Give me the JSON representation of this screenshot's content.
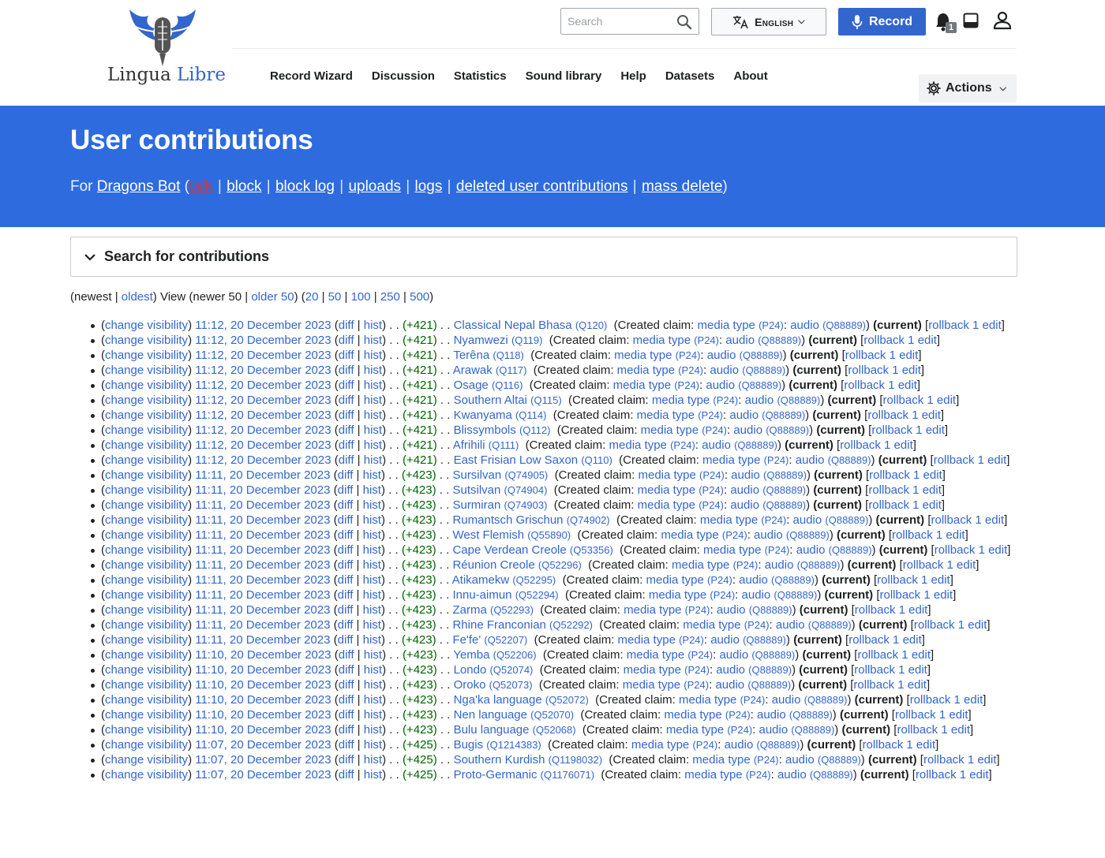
{
  "header": {
    "logo_text_a": "Lingua",
    "logo_text_b": "Libre",
    "search_placeholder": "Search",
    "language_label": "English",
    "record_label": "Record",
    "notification_count": "1",
    "actions_label": "Actions",
    "nav": [
      "Record Wizard",
      "Discussion",
      "Statistics",
      "Sound library",
      "Help",
      "Datasets",
      "About"
    ]
  },
  "banner": {
    "title": "User contributions",
    "for_prefix": "For",
    "user": "Dragons Bot",
    "links": [
      "talk",
      "block",
      "block log",
      "uploads",
      "logs",
      "deleted user contributions",
      "mass delete"
    ]
  },
  "search_panel": {
    "label": "Search for contributions"
  },
  "pager": {
    "newest": "newest",
    "oldest": "oldest",
    "view": "View",
    "newer": "newer 50",
    "older": "older 50",
    "sizes": [
      "20",
      "50",
      "100",
      "250",
      "500"
    ]
  },
  "labels": {
    "change_visibility": "change visibility",
    "diff": "diff",
    "hist": "hist",
    "created_claim": "Created claim:",
    "media_type": "media type",
    "media_type_id": "(P24)",
    "audio": "audio",
    "audio_id": "(Q88889)",
    "current": "(current)",
    "rollback": "rollback 1 edit"
  },
  "contributions": [
    {
      "time": "11:12, 20 December 2023",
      "size": "(+421)",
      "page": "Classical Nepal Bhasa",
      "qid": "(Q120)"
    },
    {
      "time": "11:12, 20 December 2023",
      "size": "(+421)",
      "page": "Nyamwezi",
      "qid": "(Q119)"
    },
    {
      "time": "11:12, 20 December 2023",
      "size": "(+421)",
      "page": "Terêna",
      "qid": "(Q118)"
    },
    {
      "time": "11:12, 20 December 2023",
      "size": "(+421)",
      "page": "Arawak",
      "qid": "(Q117)"
    },
    {
      "time": "11:12, 20 December 2023",
      "size": "(+421)",
      "page": "Osage",
      "qid": "(Q116)"
    },
    {
      "time": "11:12, 20 December 2023",
      "size": "(+421)",
      "page": "Southern Altai",
      "qid": "(Q115)"
    },
    {
      "time": "11:12, 20 December 2023",
      "size": "(+421)",
      "page": "Kwanyama",
      "qid": "(Q114)"
    },
    {
      "time": "11:12, 20 December 2023",
      "size": "(+421)",
      "page": "Blissymbols",
      "qid": "(Q112)"
    },
    {
      "time": "11:12, 20 December 2023",
      "size": "(+421)",
      "page": "Afrihili",
      "qid": "(Q111)"
    },
    {
      "time": "11:12, 20 December 2023",
      "size": "(+421)",
      "page": "East Frisian Low Saxon",
      "qid": "(Q110)"
    },
    {
      "time": "11:11, 20 December 2023",
      "size": "(+423)",
      "page": "Sursilvan",
      "qid": "(Q74905)"
    },
    {
      "time": "11:11, 20 December 2023",
      "size": "(+423)",
      "page": "Sutsilvan",
      "qid": "(Q74904)"
    },
    {
      "time": "11:11, 20 December 2023",
      "size": "(+423)",
      "page": "Surmiran",
      "qid": "(Q74903)"
    },
    {
      "time": "11:11, 20 December 2023",
      "size": "(+423)",
      "page": "Rumantsch Grischun",
      "qid": "(Q74902)"
    },
    {
      "time": "11:11, 20 December 2023",
      "size": "(+423)",
      "page": "West Flemish",
      "qid": "(Q55890)"
    },
    {
      "time": "11:11, 20 December 2023",
      "size": "(+423)",
      "page": "Cape Verdean Creole",
      "qid": "(Q53356)"
    },
    {
      "time": "11:11, 20 December 2023",
      "size": "(+423)",
      "page": "Réunion Creole",
      "qid": "(Q52296)"
    },
    {
      "time": "11:11, 20 December 2023",
      "size": "(+423)",
      "page": "Atikamekw",
      "qid": "(Q52295)"
    },
    {
      "time": "11:11, 20 December 2023",
      "size": "(+423)",
      "page": "Innu-aimun",
      "qid": "(Q52294)"
    },
    {
      "time": "11:11, 20 December 2023",
      "size": "(+423)",
      "page": "Zarma",
      "qid": "(Q52293)"
    },
    {
      "time": "11:11, 20 December 2023",
      "size": "(+423)",
      "page": "Rhine Franconian",
      "qid": "(Q52292)"
    },
    {
      "time": "11:11, 20 December 2023",
      "size": "(+423)",
      "page": "Fe'fe'",
      "qid": "(Q52207)"
    },
    {
      "time": "11:10, 20 December 2023",
      "size": "(+423)",
      "page": "Yemba",
      "qid": "(Q52206)"
    },
    {
      "time": "11:10, 20 December 2023",
      "size": "(+423)",
      "page": "Londo",
      "qid": "(Q52074)"
    },
    {
      "time": "11:10, 20 December 2023",
      "size": "(+423)",
      "page": "Oroko",
      "qid": "(Q52073)"
    },
    {
      "time": "11:10, 20 December 2023",
      "size": "(+423)",
      "page": "Nga'ka language",
      "qid": "(Q52072)"
    },
    {
      "time": "11:10, 20 December 2023",
      "size": "(+423)",
      "page": "Nen language",
      "qid": "(Q52070)"
    },
    {
      "time": "11:10, 20 December 2023",
      "size": "(+423)",
      "page": "Bulu language",
      "qid": "(Q52068)"
    },
    {
      "time": "11:07, 20 December 2023",
      "size": "(+425)",
      "page": "Bugis",
      "qid": "(Q1214383)"
    },
    {
      "time": "11:07, 20 December 2023",
      "size": "(+425)",
      "page": "Southern Kurdish",
      "qid": "(Q1198032)"
    },
    {
      "time": "11:07, 20 December 2023",
      "size": "(+425)",
      "page": "Proto-Germanic",
      "qid": "(Q1176071)"
    }
  ]
}
